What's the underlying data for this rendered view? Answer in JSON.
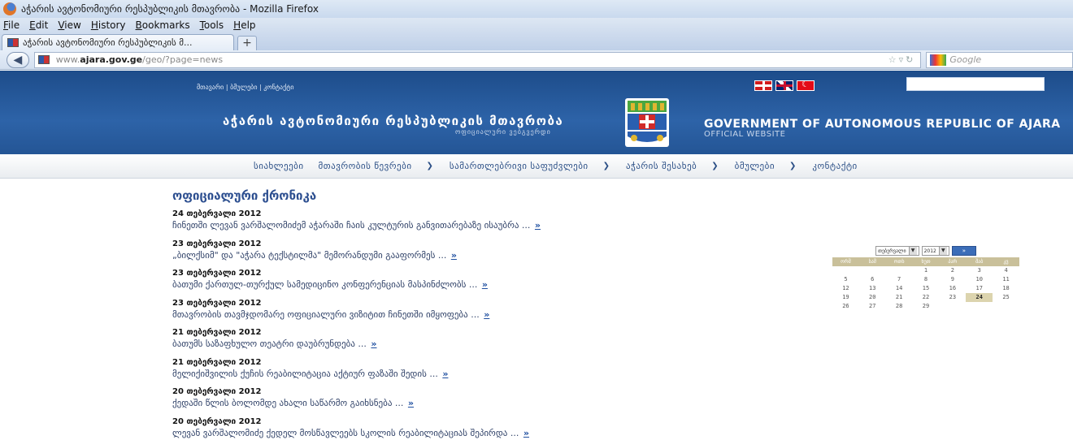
{
  "browser": {
    "window_title": "აჭარის ავტონომიური რესპუბლიკის მთავრობა - Mozilla Firefox",
    "menu": [
      "File",
      "Edit",
      "View",
      "History",
      "Bookmarks",
      "Tools",
      "Help"
    ],
    "tab_title": "აჭარის ავტონომიური რესპუბლიკის მ...",
    "new_tab_symbol": "+",
    "url_prefix": "www.",
    "url_domain": "ajara.gov.ge",
    "url_path": "/geo/?page=news",
    "search_placeholder": "Google"
  },
  "header": {
    "top_links": "მთავარი | ბმულები | კონტაქტი",
    "title_ge": "აჭარის ავტონომიური რესპუბლიკის მთავრობა",
    "subtitle_ge": "ოფიციალური ვებგვერდი",
    "title_en": "GOVERNMENT OF AUTONOMOUS REPUBLIC OF AJARA",
    "subtitle_en": "OFFICIAL WEBSITE",
    "emblem_colors": {
      "blue": "#2a5fb0",
      "red": "#d12a2a",
      "green": "#4aa640",
      "gold": "#e0b631"
    }
  },
  "nav": [
    {
      "label": "სიახლეები",
      "has_dropdown": false
    },
    {
      "label": "მთავრობის წევრები",
      "has_dropdown": true
    },
    {
      "label": "სამართლებრივი საფუძვლები",
      "has_dropdown": true
    },
    {
      "label": "აჭარის შესახებ",
      "has_dropdown": true
    },
    {
      "label": "ბმულები",
      "has_dropdown": true
    },
    {
      "label": "კონტაქტი",
      "has_dropdown": false
    }
  ],
  "nav_arrow": "❯",
  "news": {
    "heading": "ოფიციალური ქრონიკა",
    "more_symbol": "»",
    "items": [
      {
        "date": "24 თებერვალი 2012",
        "title": "ჩინეთში ლევან ვარშალომიძემ აჭარაში ჩაის კულტურის განვითარებაზე ისაუბრა ..."
      },
      {
        "date": "23 თებერვალი 2012",
        "title": "„ბილქსიმ\" და \"აჭარა ტექსტილმა\" მემორანდუმი გააფორმეს ..."
      },
      {
        "date": "23 თებერვალი 2012",
        "title": "ბათუმი ქართულ-თურქულ სამედიცინო კონფერენციას მასპინძლობს ..."
      },
      {
        "date": "23 თებერვალი 2012",
        "title": "მთავრობის თავმჯდომარე ოფიციალური ვიზიტით ჩინეთში იმყოფება ..."
      },
      {
        "date": "21 თებერვალი 2012",
        "title": "ბათუმს საზაფხულო თეატრი დაუბრუნდება ..."
      },
      {
        "date": "21 თებერვალი 2012",
        "title": "მელიქიშვილის ქუჩის რეაბილიტაცია აქტიურ ფაზაში შედის ..."
      },
      {
        "date": "20 თებერვალი 2012",
        "title": "ქედაში წლის ბოლომდე ახალი საწარმო გაიხსნება ..."
      },
      {
        "date": "20 თებერვალი 2012",
        "title": "ლევან ვარშალომიძე ქედელ მოსწავლეებს სკოლის რეაბილიტაციას შეპირდა ..."
      }
    ]
  },
  "calendar": {
    "month": "თებერვალი",
    "year": "2012",
    "go_label": "»",
    "weekdays": [
      "ორშ",
      "სამ",
      "ოთხ",
      "ხუთ",
      "პარ",
      "შაბ",
      "კვ"
    ],
    "days": [
      "",
      "",
      "",
      "1",
      "2",
      "3",
      "4",
      "5",
      "6",
      "7",
      "8",
      "9",
      "10",
      "11",
      "12",
      "13",
      "14",
      "15",
      "16",
      "17",
      "18",
      "19",
      "20",
      "21",
      "22",
      "23",
      "24",
      "25",
      "26",
      "27",
      "28",
      "29",
      "",
      "",
      ""
    ],
    "today": "24",
    "header_color": "#c9c09a"
  }
}
